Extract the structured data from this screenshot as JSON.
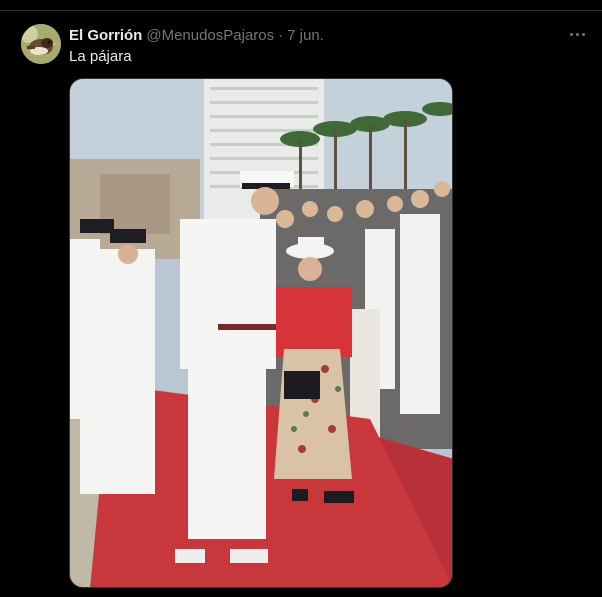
{
  "tweet": {
    "display_name": "El Gorrión",
    "handle": "@MenudosPajaros",
    "separator": "·",
    "timestamp": "7 jun.",
    "text": "La pájara"
  },
  "icons": {
    "more": "more-horizontal-icon",
    "avatar": "sparrow-avatar"
  },
  "colors": {
    "background": "#000000",
    "primary_text": "#e7e9ea",
    "secondary_text": "#71767b",
    "divider": "#2f3336"
  }
}
